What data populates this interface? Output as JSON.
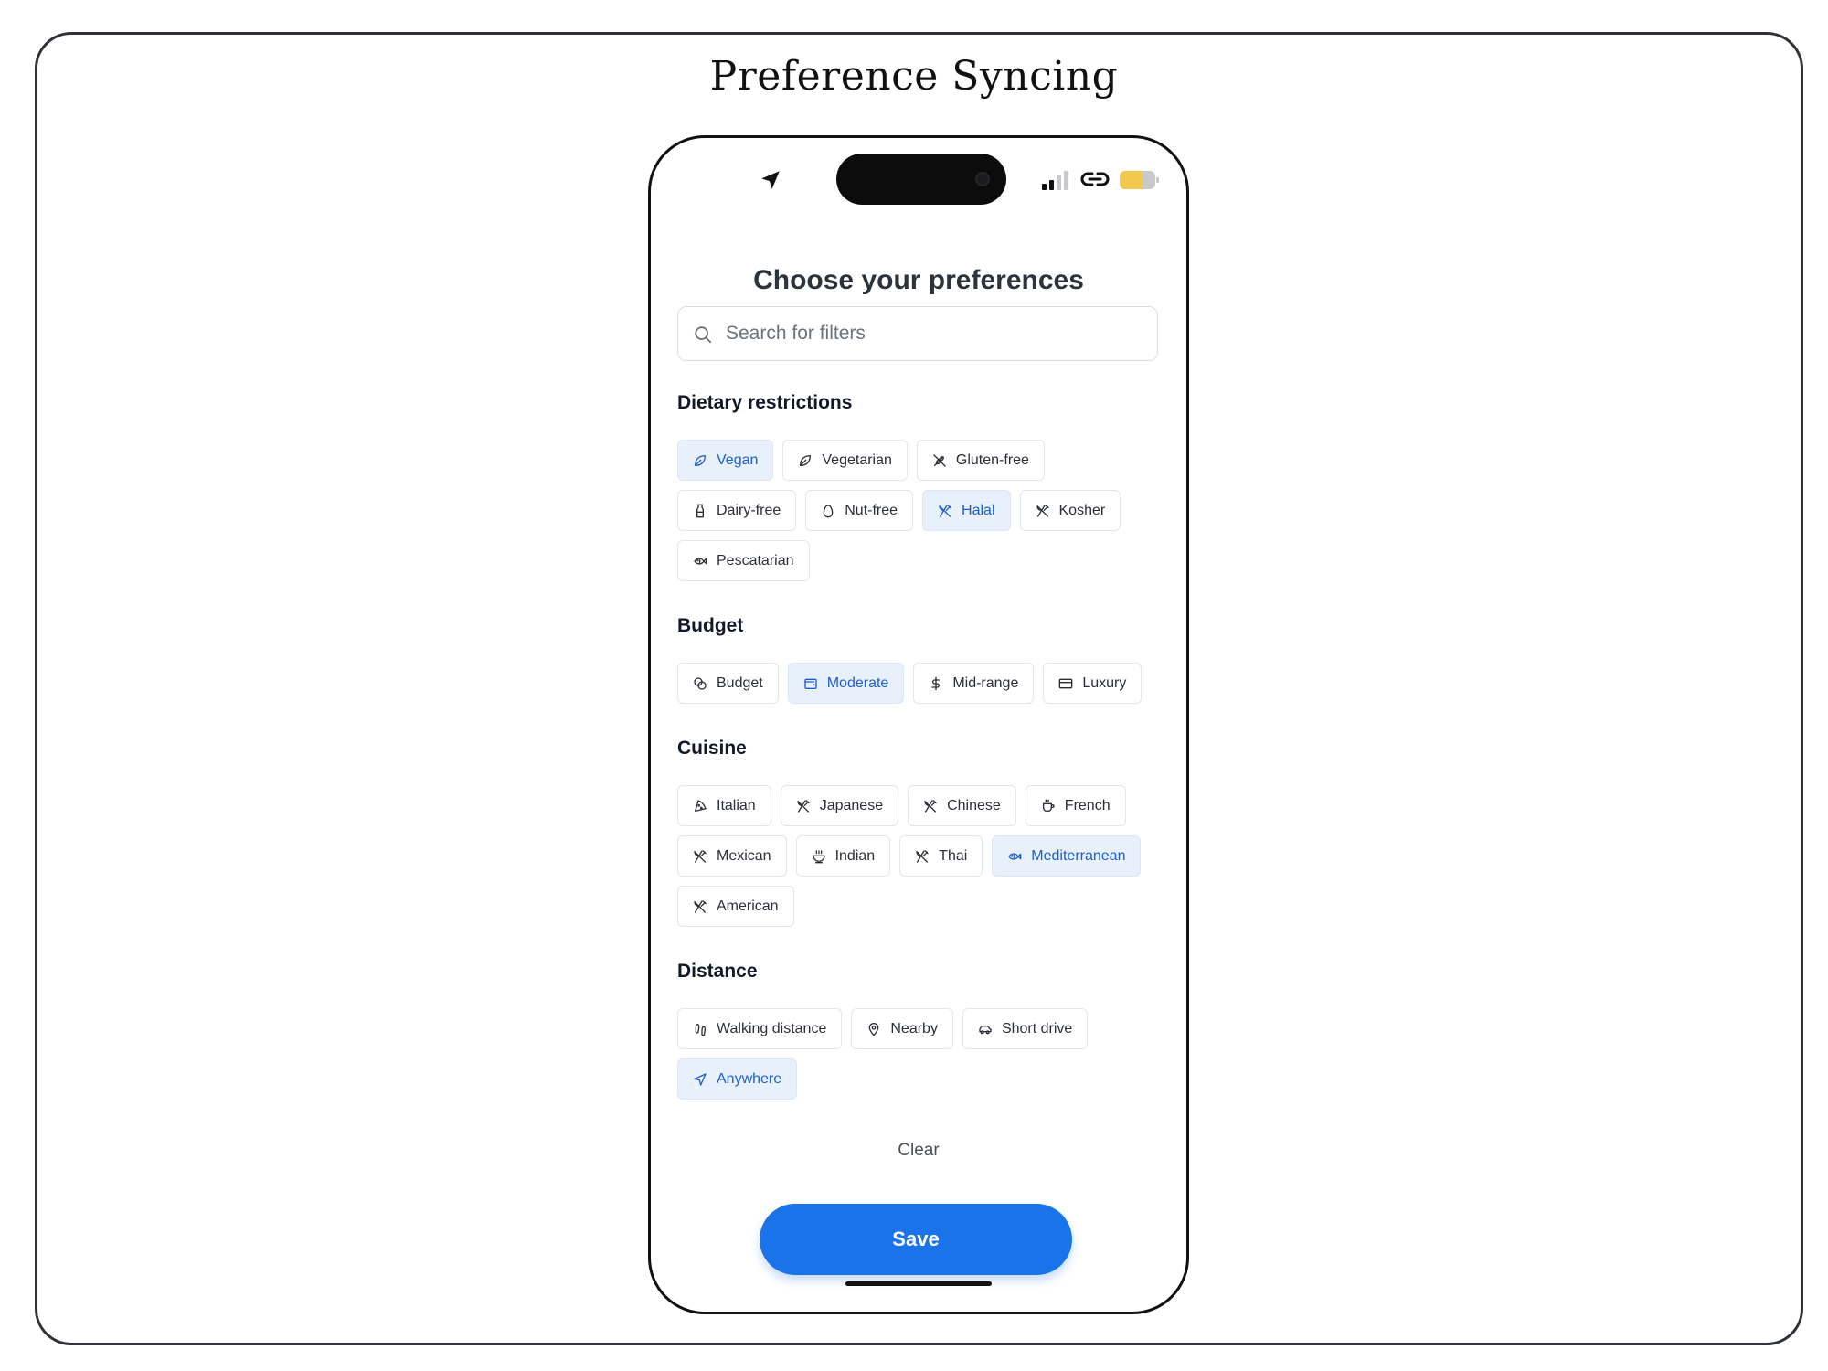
{
  "page_title": "Preference Syncing",
  "screen": {
    "heading": "Choose your preferences",
    "search": {
      "placeholder": "Search for filters",
      "value": ""
    },
    "sections": [
      {
        "id": "dietary",
        "title": "Dietary restrictions",
        "chips": [
          {
            "label": "Vegan",
            "icon": "leaf-icon",
            "selected": true
          },
          {
            "label": "Vegetarian",
            "icon": "leaf-icon",
            "selected": false
          },
          {
            "label": "Gluten-free",
            "icon": "wheat-off-icon",
            "selected": false
          },
          {
            "label": "Dairy-free",
            "icon": "milk-icon",
            "selected": false
          },
          {
            "label": "Nut-free",
            "icon": "egg-icon",
            "selected": false
          },
          {
            "label": "Halal",
            "icon": "utensils-crossed-icon",
            "selected": true
          },
          {
            "label": "Kosher",
            "icon": "utensils-crossed-icon",
            "selected": false
          },
          {
            "label": "Pescatarian",
            "icon": "fish-icon",
            "selected": false
          }
        ]
      },
      {
        "id": "budget",
        "title": "Budget",
        "chips": [
          {
            "label": "Budget",
            "icon": "coins-icon",
            "selected": false
          },
          {
            "label": "Moderate",
            "icon": "wallet-icon",
            "selected": true
          },
          {
            "label": "Mid-range",
            "icon": "dollar-icon",
            "selected": false
          },
          {
            "label": "Luxury",
            "icon": "credit-card-icon",
            "selected": false
          }
        ]
      },
      {
        "id": "cuisine",
        "title": "Cuisine",
        "chips": [
          {
            "label": "Italian",
            "icon": "pizza-icon",
            "selected": false
          },
          {
            "label": "Japanese",
            "icon": "utensils-crossed-icon",
            "selected": false
          },
          {
            "label": "Chinese",
            "icon": "utensils-crossed-icon",
            "selected": false
          },
          {
            "label": "French",
            "icon": "coffee-icon",
            "selected": false
          },
          {
            "label": "Mexican",
            "icon": "utensils-crossed-icon",
            "selected": false
          },
          {
            "label": "Indian",
            "icon": "soup-icon",
            "selected": false
          },
          {
            "label": "Thai",
            "icon": "utensils-crossed-icon",
            "selected": false
          },
          {
            "label": "Mediterranean",
            "icon": "fish-icon",
            "selected": true
          },
          {
            "label": "American",
            "icon": "utensils-crossed-icon",
            "selected": false
          }
        ]
      },
      {
        "id": "distance",
        "title": "Distance",
        "chips": [
          {
            "label": "Walking distance",
            "icon": "footprints-icon",
            "selected": false
          },
          {
            "label": "Nearby",
            "icon": "map-pin-icon",
            "selected": false
          },
          {
            "label": "Short drive",
            "icon": "car-icon",
            "selected": false
          },
          {
            "label": "Anywhere",
            "icon": "navigation-icon",
            "selected": true
          }
        ]
      }
    ],
    "clear_label": "Clear",
    "save_label": "Save"
  },
  "colors": {
    "accent": "#1a73e8",
    "selected_chip_bg": "#e8f0fc",
    "selected_chip_text": "#1d5fc7",
    "battery_fill": "#f2c94c"
  }
}
